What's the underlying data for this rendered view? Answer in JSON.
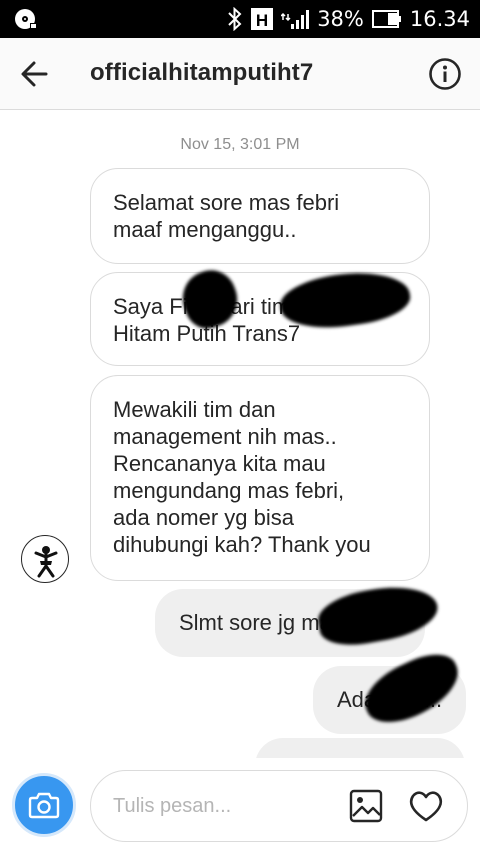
{
  "status_bar": {
    "battery_percent": "38%",
    "time": "16.34",
    "network_label": "H",
    "icons": [
      "vinyl-icon",
      "bluetooth-icon",
      "network-h-icon",
      "signal-icon",
      "battery-icon"
    ]
  },
  "header": {
    "title": "officialhitamputiht7",
    "back_icon": "back-arrow-icon",
    "info_icon": "info-icon"
  },
  "conversation": {
    "timestamp": "Nov 15, 3:01 PM",
    "incoming": [
      {
        "text": "Selamat sore mas febri\nmaaf menganggu.."
      },
      {
        "text": "Saya Fitry dari tim Official\nHitam Putih Trans7"
      },
      {
        "text": "Mewakili tim dan\nmanagement nih mas..\nRencananya kita mau\nmengundang mas febri,\nada nomer yg bisa\ndihubungi kah? Thank you"
      }
    ],
    "outgoing": [
      {
        "text": "Slmt sore jg mas fitry..."
      },
      {
        "text": "Ada mas..."
      },
      {
        "text": ""
      }
    ],
    "avatar_icon": "hitam-putih-logo-avatar"
  },
  "composer": {
    "placeholder": "Tulis pesan...",
    "value": "",
    "camera_icon": "camera-icon",
    "gallery_icon": "gallery-icon",
    "heart_icon": "heart-icon"
  },
  "colors": {
    "accent": "#3897f0",
    "bubble_border": "#dbdbdb",
    "outgoing_bg": "#efefef",
    "text": "#262626",
    "muted": "#8e8e8e"
  }
}
